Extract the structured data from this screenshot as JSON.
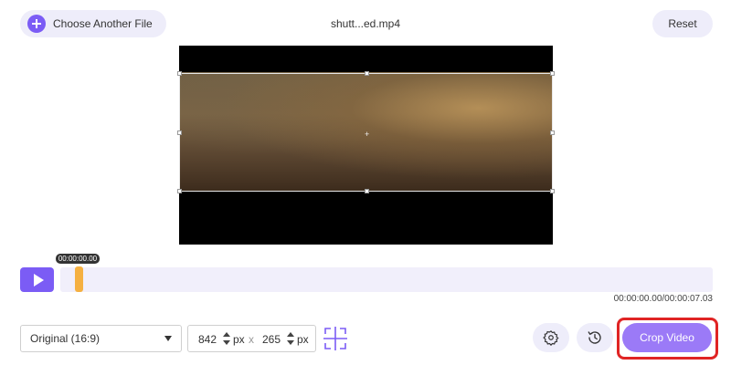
{
  "header": {
    "choose_label": "Choose Another File",
    "filename": "shutt...ed.mp4",
    "reset_label": "Reset"
  },
  "player": {
    "current_tip": "00:00:00.00",
    "time_readout": "00:00:00.00/00:00:07.03"
  },
  "controls": {
    "aspect_ratio": "Original (16:9)",
    "width": "842",
    "height": "265",
    "unit": "px",
    "separator": "x",
    "crop_label": "Crop Video"
  },
  "colors": {
    "accent": "#7b5cf5",
    "crop_button": "#9b7af7",
    "highlight": "#e02424",
    "marker": "#f5b041"
  },
  "icons": {
    "add": "plus-circle-icon",
    "play": "play-icon",
    "crop": "crop-center-icon",
    "settings": "gear-icon",
    "history": "history-icon"
  }
}
